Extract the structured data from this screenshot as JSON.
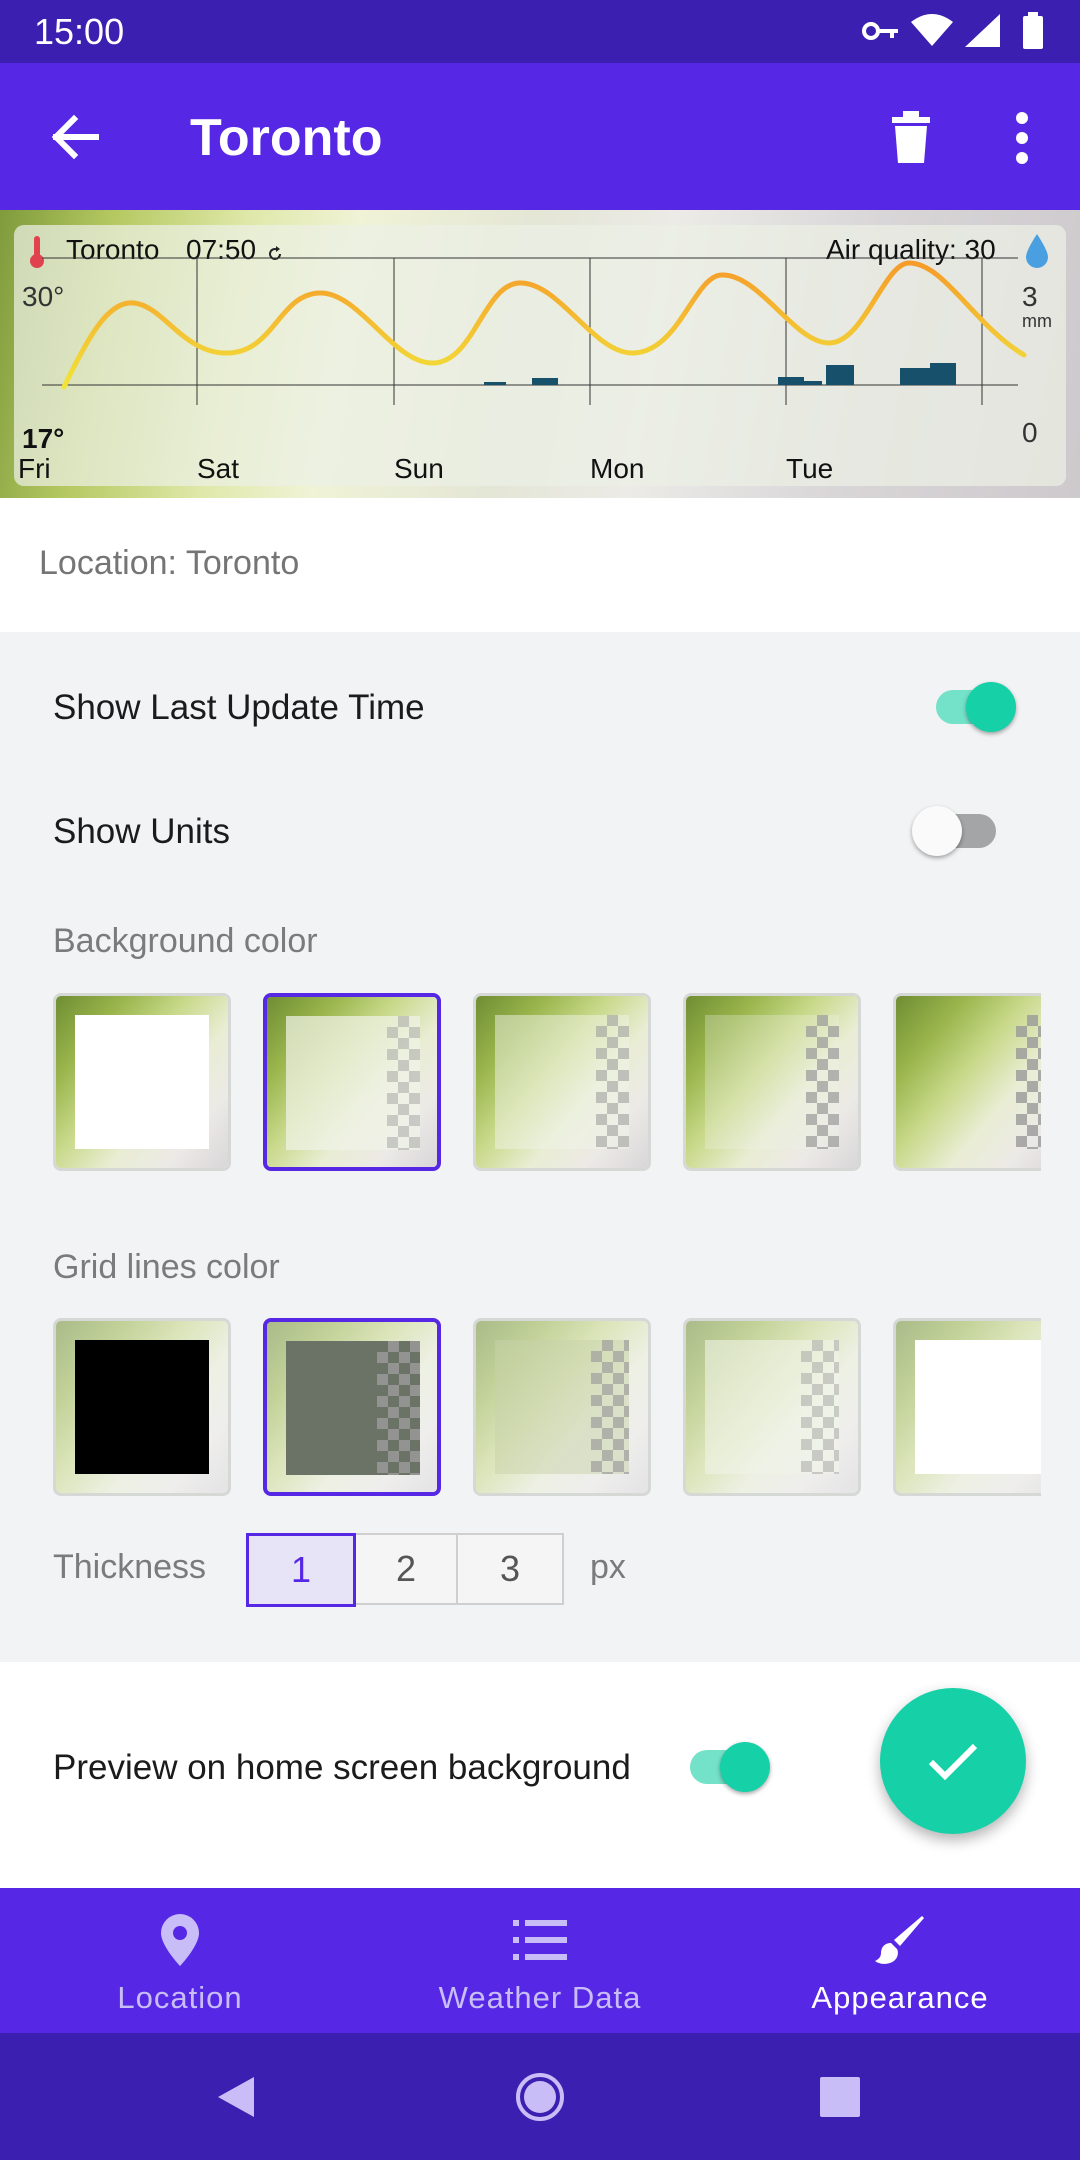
{
  "status_bar": {
    "time": "15:00"
  },
  "app_bar": {
    "title": "Toronto"
  },
  "widget": {
    "location": "Toronto",
    "time": "07:50",
    "air_quality": "Air quality: 30",
    "temp_max_label": "30°",
    "temp_min_label": "17°",
    "precip_max": "3",
    "precip_unit": "mm",
    "precip_min": "0",
    "days": [
      "Fri",
      "Sat",
      "Sun",
      "Mon",
      "Tue"
    ]
  },
  "location_row": {
    "label": "Location: Toronto"
  },
  "settings": {
    "show_last_update": {
      "label": "Show Last Update Time",
      "on": true
    },
    "show_units": {
      "label": "Show Units",
      "on": false
    },
    "background_color_label": "Background color",
    "grid_lines_color_label": "Grid lines color",
    "thickness": {
      "label": "Thickness",
      "options": [
        "1",
        "2",
        "3"
      ],
      "selected": "1",
      "unit": "px"
    },
    "preview_home": {
      "label": "Preview on home screen background",
      "on": true
    }
  },
  "bottom_nav": {
    "items": [
      {
        "label": "Location",
        "icon": "location-pin-icon"
      },
      {
        "label": "Weather Data",
        "icon": "list-icon"
      },
      {
        "label": "Appearance",
        "icon": "paintbrush-icon",
        "active": true
      }
    ]
  },
  "colors": {
    "primary": "#5628e6",
    "status_bar": "#3b1fb0",
    "accent": "#16d0a8"
  }
}
